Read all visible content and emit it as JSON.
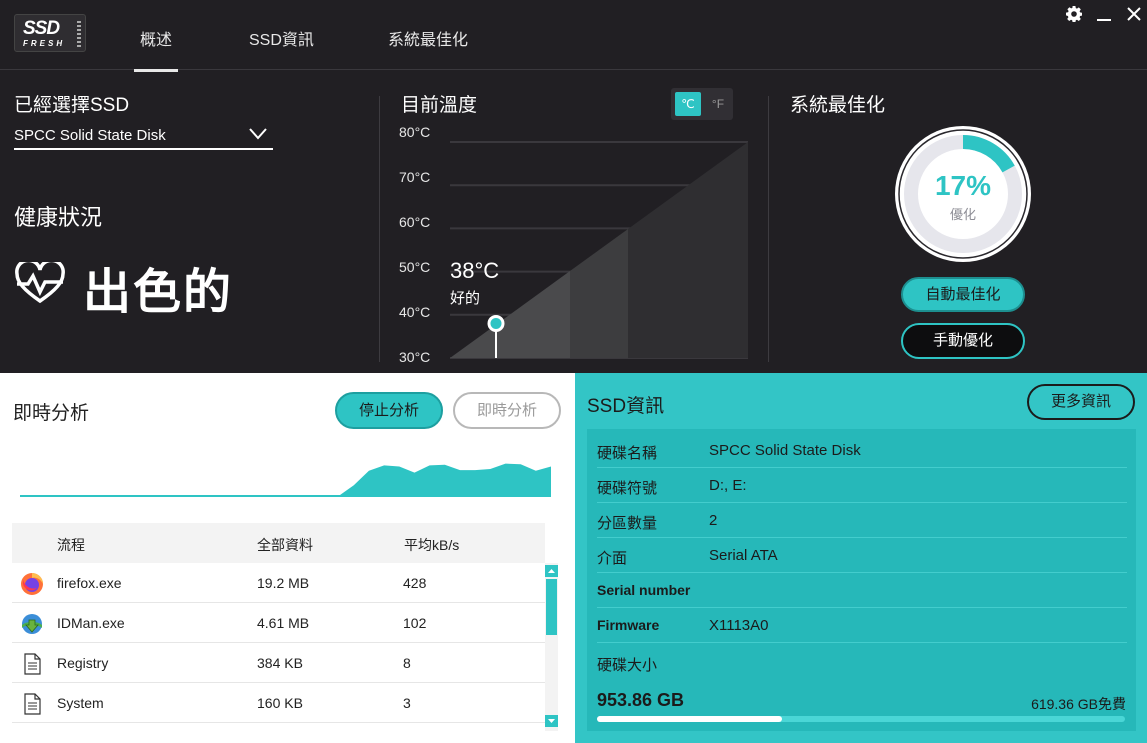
{
  "app": {
    "logo_top": "SSD",
    "logo_bottom": "FRESH",
    "tabs": [
      "概述",
      "SSD資訊",
      "系統最佳化"
    ],
    "active_tab": 0
  },
  "left": {
    "selected_label": "已經選擇SSD",
    "selected_value": "SPCC Solid State Disk",
    "health_label": "健康狀況",
    "health_value": "出色的"
  },
  "temperature": {
    "title": "目前溫度",
    "unit_c": "℃",
    "unit_f": "°F",
    "ticks": [
      "80°C",
      "70°C",
      "60°C",
      "50°C",
      "40°C",
      "30°C"
    ],
    "current_display": "38°C",
    "status": "好的",
    "current_value": 38,
    "range": [
      30,
      80
    ]
  },
  "optimize": {
    "title": "系統最佳化",
    "percent_display": "17%",
    "percent_value": 17,
    "label": "優化",
    "auto_button": "自動最佳化",
    "manual_button": "手動優化"
  },
  "realtime": {
    "title": "即時分析",
    "stop_button": "停止分析",
    "start_button": "即時分析",
    "activity_series": [
      0,
      0,
      0,
      0,
      0,
      0,
      0,
      0,
      0,
      0,
      0,
      0,
      0,
      0,
      0,
      0,
      0,
      0,
      0,
      0,
      0,
      0,
      0.3,
      0.7,
      0.85,
      0.82,
      0.65,
      0.85,
      0.87,
      0.72,
      0.72,
      0.75,
      0.9,
      0.88,
      0.7,
      0.82
    ]
  },
  "process_table": {
    "headers": [
      "流程",
      "全部資料",
      "平均kB/s"
    ],
    "rows": [
      {
        "icon": "firefox-icon",
        "name": "firefox.exe",
        "total": "19.2 MB",
        "avg": "428"
      },
      {
        "icon": "idman-icon",
        "name": "IDMan.exe",
        "total": "4.61 MB",
        "avg": "102"
      },
      {
        "icon": "document-icon",
        "name": "Registry",
        "total": "384 KB",
        "avg": "8"
      },
      {
        "icon": "document-icon",
        "name": "System",
        "total": "160 KB",
        "avg": "3"
      }
    ]
  },
  "ssd_info": {
    "title": "SSD資訊",
    "more_button": "更多資訊",
    "rows": [
      {
        "key": "硬碟名稱",
        "value": "SPCC Solid State Disk"
      },
      {
        "key": "硬碟符號",
        "value": "D:, E:"
      },
      {
        "key": "分區數量",
        "value": "2"
      },
      {
        "key": "介面",
        "value": "Serial ATA"
      },
      {
        "key": "Serial number",
        "value": ""
      },
      {
        "key": "Firmware",
        "value": "X1113A0"
      }
    ],
    "size_label": "硬碟大小",
    "size_total": "953.86 GB",
    "size_free": "619.36 GB免費",
    "used_fraction": 0.35
  },
  "colors": {
    "accent": "#2ec4c4",
    "dark_bg": "#211f23",
    "panel_teal": "#33c5c6"
  }
}
